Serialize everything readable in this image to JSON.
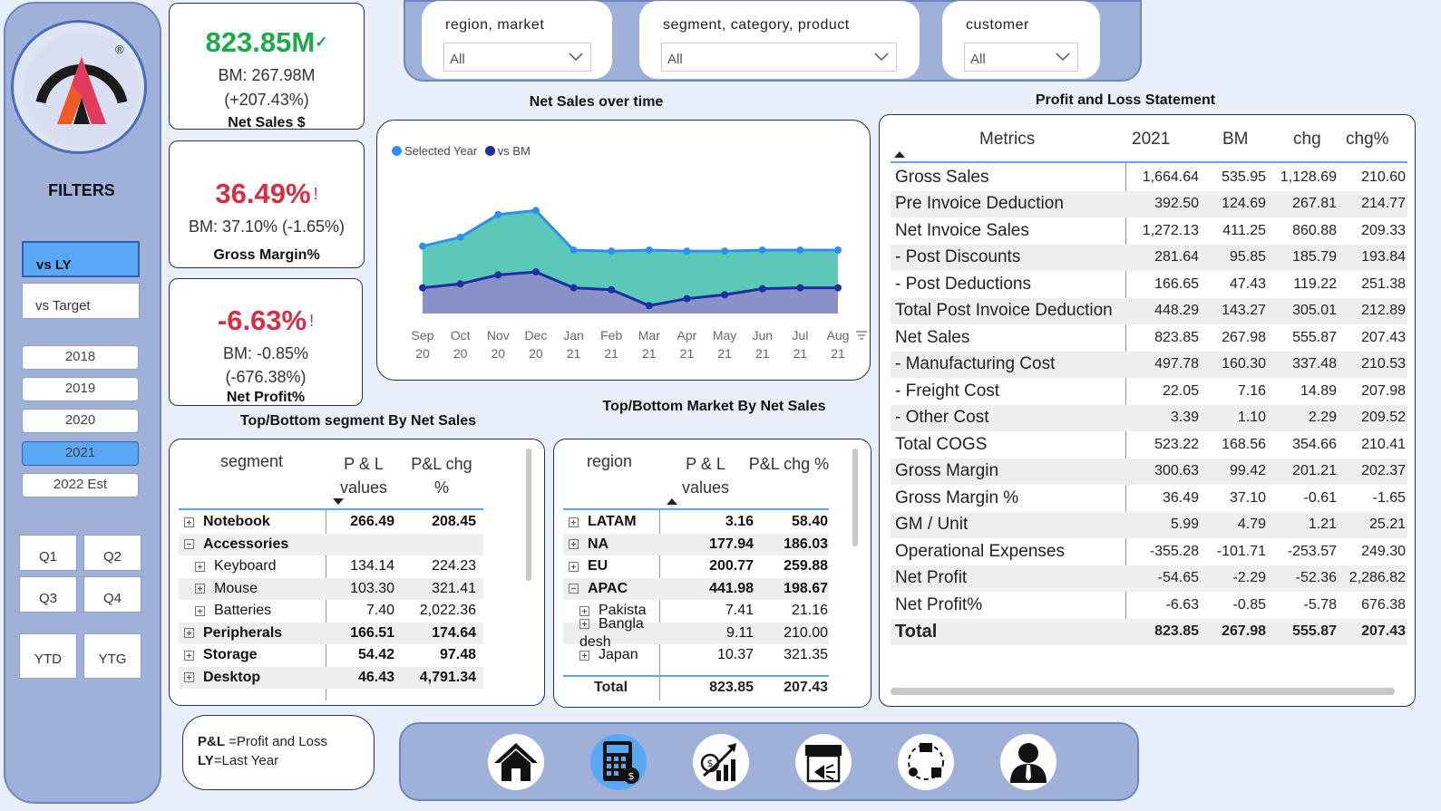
{
  "sidebar": {
    "filters_title": "FILTERS",
    "compare": [
      {
        "label": "vs LY",
        "selected": true
      },
      {
        "label": "vs Target",
        "selected": false
      }
    ],
    "years": [
      {
        "label": "2018",
        "selected": false
      },
      {
        "label": "2019",
        "selected": false
      },
      {
        "label": "2020",
        "selected": false
      },
      {
        "label": "2021",
        "selected": true
      },
      {
        "label": "2022 Est",
        "selected": false
      }
    ],
    "quarters": [
      "Q1",
      "Q2",
      "Q3",
      "Q4"
    ],
    "periods": [
      "YTD",
      "YTG"
    ],
    "logo_mark": "®"
  },
  "kpis": {
    "net_sales": {
      "value": "823.85M",
      "indicator": "✓",
      "bm": "BM: 267.98M",
      "chg": "(+207.43%)",
      "title": "Net Sales $",
      "color": "#1ea84a"
    },
    "gross_margin": {
      "value": "36.49%",
      "indicator": "!",
      "bm": "BM: 37.10% (-1.65%)",
      "title": "Gross Margin%",
      "color": "#d62f45"
    },
    "net_profit": {
      "value": "-6.63%",
      "indicator": "!",
      "bm": "BM: -0.85%",
      "chg": "(-676.38%)",
      "title": "Net Profit%",
      "color": "#d62f45"
    }
  },
  "slicers": [
    {
      "label": "region, market",
      "value": "All"
    },
    {
      "label": "segment, category, product",
      "value": "All"
    },
    {
      "label": "customer",
      "value": "All"
    }
  ],
  "chart_titles": {
    "net_sales_over_time": "Net Sales over time",
    "pl_statement": "Profit and Loss Statement",
    "segment": "Top/Bottom segment By Net Sales",
    "market": "Top/Bottom Market By Net Sales"
  },
  "chart_data": {
    "type": "area",
    "categories": [
      "Sep 20",
      "Oct 20",
      "Nov 20",
      "Dec 20",
      "Jan 21",
      "Feb 21",
      "Mar 21",
      "Apr 21",
      "May 21",
      "Jun 21",
      "Jul 21",
      "Aug 21"
    ],
    "series": [
      {
        "name": "Selected Year",
        "color": "#2e8ff0",
        "fill": "#5cc8b8",
        "values": [
          68,
          77,
          100,
          104,
          64,
          63,
          64,
          63,
          63,
          64,
          64,
          64
        ]
      },
      {
        "name": "vs BM",
        "color": "#1a2fa0",
        "fill": "#8a90c8",
        "values": [
          26,
          30,
          39,
          42,
          26,
          24,
          8,
          15,
          19,
          25,
          26,
          26
        ]
      }
    ],
    "legend_position": "top-left",
    "grid": false,
    "ylim": [
      0,
      140
    ]
  },
  "segment_table": {
    "headers": [
      "segment",
      "P & L values",
      "P&L chg %"
    ],
    "rows": [
      {
        "expand": "plus",
        "level": 0,
        "name": "Notebook",
        "value": "266.49",
        "chg": "208.45"
      },
      {
        "expand": "minus",
        "level": 0,
        "name": "Accessories",
        "value": "",
        "chg": ""
      },
      {
        "expand": "plus",
        "level": 1,
        "name": "Keyboard",
        "value": "134.14",
        "chg": "224.23"
      },
      {
        "expand": "plus",
        "level": 1,
        "name": "Mouse",
        "value": "103.30",
        "chg": "321.41"
      },
      {
        "expand": "plus",
        "level": 1,
        "name": "Batteries",
        "value": "7.40",
        "chg": "2,022.36"
      },
      {
        "expand": "plus",
        "level": 0,
        "name": "Peripherals",
        "value": "166.51",
        "chg": "174.64"
      },
      {
        "expand": "plus",
        "level": 0,
        "name": "Storage",
        "value": "54.42",
        "chg": "97.48"
      },
      {
        "expand": "plus",
        "level": 0,
        "name": "Desktop",
        "value": "46.43",
        "chg": "4,791.34"
      }
    ]
  },
  "market_table": {
    "headers": [
      "region",
      "P & L values",
      "P&L chg %"
    ],
    "rows": [
      {
        "expand": "plus",
        "level": 0,
        "name": "LATAM",
        "value": "3.16",
        "chg": "58.40"
      },
      {
        "expand": "plus",
        "level": 0,
        "name": "NA",
        "value": "177.94",
        "chg": "186.03"
      },
      {
        "expand": "plus",
        "level": 0,
        "name": "EU",
        "value": "200.77",
        "chg": "259.88"
      },
      {
        "expand": "minus",
        "level": 0,
        "name": "APAC",
        "value": "441.98",
        "chg": "198.67"
      },
      {
        "expand": "plus",
        "level": 1,
        "name": "Pakista",
        "value": "7.41",
        "chg": "21.16"
      },
      {
        "expand": "plus",
        "level": 1,
        "name": "Bangla desh",
        "value": "9.11",
        "chg": "210.00"
      },
      {
        "expand": "plus",
        "level": 1,
        "name": "Japan",
        "value": "10.37",
        "chg": "321.35"
      }
    ],
    "total": {
      "label": "Total",
      "value": "823.85",
      "chg": "207.43"
    }
  },
  "pl_table": {
    "headers": [
      "Metrics",
      "2021",
      "BM",
      "chg",
      "chg%"
    ],
    "rows": [
      {
        "metric": "Gross Sales",
        "y2021": "1,664.64",
        "bm": "535.95",
        "chg": "1,128.69",
        "chgp": "210.60"
      },
      {
        "metric": "Pre Invoice Deduction",
        "y2021": "392.50",
        "bm": "124.69",
        "chg": "267.81",
        "chgp": "214.77"
      },
      {
        "metric": "Net Invoice Sales",
        "y2021": "1,272.13",
        "bm": "411.25",
        "chg": "860.88",
        "chgp": "209.33"
      },
      {
        "metric": "- Post Discounts",
        "y2021": "281.64",
        "bm": "95.85",
        "chg": "185.79",
        "chgp": "193.84"
      },
      {
        "metric": "- Post Deductions",
        "y2021": "166.65",
        "bm": "47.43",
        "chg": "119.22",
        "chgp": "251.38"
      },
      {
        "metric": "Total Post Invoice Deduction",
        "y2021": "448.29",
        "bm": "143.27",
        "chg": "305.01",
        "chgp": "212.89"
      },
      {
        "metric": "Net Sales",
        "y2021": "823.85",
        "bm": "267.98",
        "chg": "555.87",
        "chgp": "207.43"
      },
      {
        "metric": "- Manufacturing Cost",
        "y2021": "497.78",
        "bm": "160.30",
        "chg": "337.48",
        "chgp": "210.53"
      },
      {
        "metric": "- Freight Cost",
        "y2021": "22.05",
        "bm": "7.16",
        "chg": "14.89",
        "chgp": "207.98"
      },
      {
        "metric": "- Other Cost",
        "y2021": "3.39",
        "bm": "1.10",
        "chg": "2.29",
        "chgp": "209.52"
      },
      {
        "metric": "Total COGS",
        "y2021": "523.22",
        "bm": "168.56",
        "chg": "354.66",
        "chgp": "210.41"
      },
      {
        "metric": "Gross Margin",
        "y2021": "300.63",
        "bm": "99.42",
        "chg": "201.21",
        "chgp": "202.37"
      },
      {
        "metric": "Gross Margin %",
        "y2021": "36.49",
        "bm": "37.10",
        "chg": "-0.61",
        "chgp": "-1.65"
      },
      {
        "metric": "GM / Unit",
        "y2021": "5.99",
        "bm": "4.79",
        "chg": "1.21",
        "chgp": "25.21"
      },
      {
        "metric": "Operational Expenses",
        "y2021": "-355.28",
        "bm": "-101.71",
        "chg": "-253.57",
        "chgp": "249.30"
      },
      {
        "metric": "Net Profit",
        "y2021": "-54.65",
        "bm": "-2.29",
        "chg": "-52.36",
        "chgp": "2,286.82"
      },
      {
        "metric": "Net Profit%",
        "y2021": "-6.63",
        "bm": "-0.85",
        "chg": "-5.78",
        "chgp": "676.38"
      },
      {
        "metric": "Total",
        "y2021": "823.85",
        "bm": "267.98",
        "chg": "555.87",
        "chgp": "207.43",
        "bold": true
      }
    ]
  },
  "note": {
    "pl_abbr": "P&L",
    "pl_text": " =Profit and Loss",
    "ly_abbr": "LY",
    "ly_text": "=Last Year"
  },
  "nav": [
    {
      "icon": "home-icon",
      "selected": false
    },
    {
      "icon": "calculator-icon",
      "selected": true
    },
    {
      "icon": "growth-chart-icon",
      "selected": false
    },
    {
      "icon": "store-icon",
      "selected": false
    },
    {
      "icon": "supply-chain-icon",
      "selected": false
    },
    {
      "icon": "executive-icon",
      "selected": false
    }
  ]
}
